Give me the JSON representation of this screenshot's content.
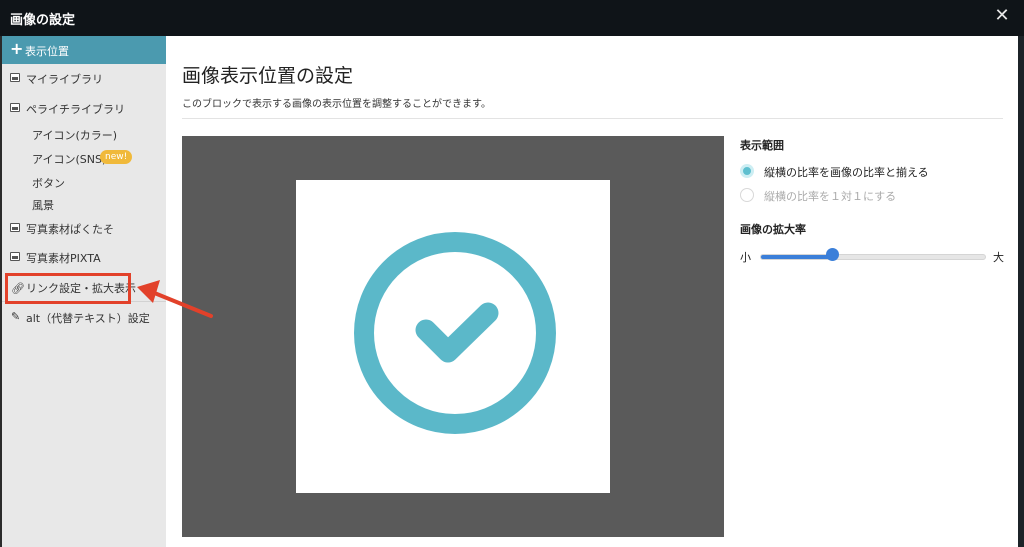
{
  "window": {
    "title": "画像の設定",
    "close_icon": "close-icon"
  },
  "sidebar": {
    "top_item": {
      "label": "表示位置",
      "icon": "plus-icon"
    },
    "items": [
      {
        "label": "マイライブラリ",
        "icon": "image-icon"
      },
      {
        "label": "ペライチライブラリ",
        "icon": "image-icon"
      }
    ],
    "sub_items": [
      {
        "label": "アイコン(カラー)"
      },
      {
        "label": "アイコン(SNS)",
        "badge": "new!"
      },
      {
        "label": "ボタン"
      },
      {
        "label": "風景"
      }
    ],
    "items2": [
      {
        "label": "写真素材ぱくたそ",
        "icon": "image-icon"
      },
      {
        "label": "写真素材PIXTA",
        "icon": "image-icon"
      }
    ],
    "link_item": {
      "label": "リンク設定・拡大表示",
      "icon": "link-icon"
    },
    "alt_item": {
      "label": "alt（代替テキスト）設定",
      "icon": "pencil-icon"
    }
  },
  "main": {
    "title": "画像表示位置の設定",
    "description": "このブロックで表示する画像の表示位置を調整することができます。",
    "preview_icon": "check-circle-icon"
  },
  "settings": {
    "range_heading": "表示範囲",
    "options": [
      {
        "label": "縦横の比率を画像の比率と揃える",
        "selected": true
      },
      {
        "label": "縦横の比率を１対１にする",
        "selected": false
      }
    ],
    "zoom_heading": "画像の拡大率",
    "zoom_min": "小",
    "zoom_max": "大",
    "zoom_value": 0.32
  },
  "colors": {
    "accent": "#4b9aaf",
    "check": "#5bb8c9",
    "highlight": "#e2412a",
    "slider": "#3b7fd9",
    "badge": "#f0b93a"
  }
}
